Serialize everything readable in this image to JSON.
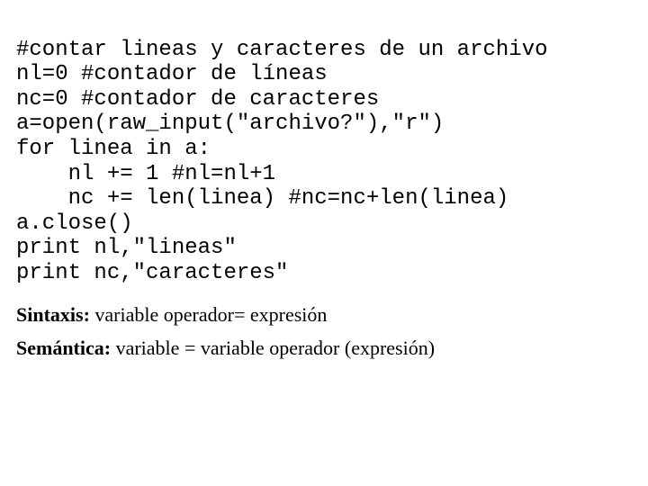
{
  "code": {
    "lines": [
      "#contar lineas y caracteres de un archivo",
      "nl=0 #contador de líneas",
      "nc=0 #contador de caracteres",
      "a=open(raw_input(\"archivo?\"),\"r\")",
      "for linea in a:",
      "    nl += 1 #nl=nl+1",
      "    nc += len(linea) #nc=nc+len(linea)",
      "a.close()",
      "print nl,\"lineas\"",
      "print nc,\"caracteres\""
    ]
  },
  "notes": {
    "sintaxis_label": "Sintaxis:",
    "sintaxis_text": " variable operador= expresión",
    "semantica_label": "Semántica:",
    "semantica_text": " variable = variable operador (expresión)"
  }
}
